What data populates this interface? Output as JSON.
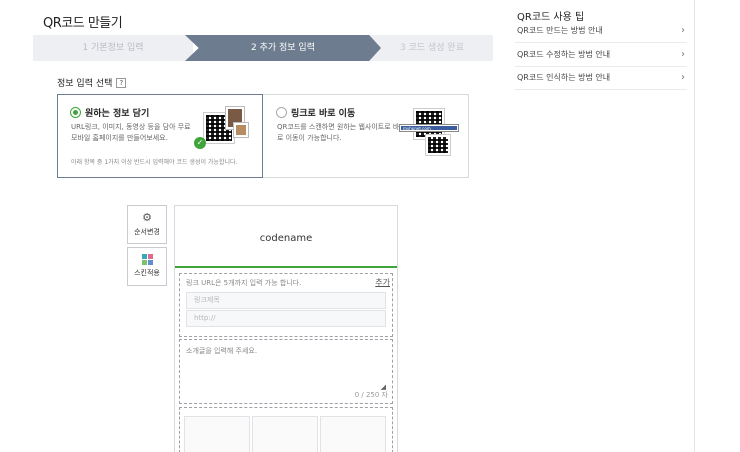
{
  "page_title": "QR코드 만들기",
  "steps": [
    {
      "label": "1 기본정보 입력",
      "state": "done"
    },
    {
      "label": "2 추가 정보 입력",
      "state": "active"
    },
    {
      "label": "3 코드 생성 완료",
      "state": "pending"
    }
  ],
  "section": {
    "label": "정보 입력 선택",
    "help_icon": "?"
  },
  "options": [
    {
      "title": "원하는 정보 담기",
      "selected": true,
      "description": "URL링크, 이미지, 동영상 등을 담아 무료 모바일 홈페이지를 만들어보세요.",
      "note": "아래 항목 중 1가지 이상 반드시 입력해야 코드 생성이 가능합니다."
    },
    {
      "title": "링크로 바로 이동",
      "selected": false,
      "description": "QR코드를 스캔하면 원하는 웹사이트로 바로 이동이 가능합니다.",
      "url_sample": "myhpnet.com"
    }
  ],
  "tools": [
    {
      "label": "순서변경",
      "icon": "gear-icon"
    },
    {
      "label": "스킨적용",
      "icon": "grid-icon"
    }
  ],
  "editor": {
    "codename": "codename",
    "link_hint": "링크 URL은 5개까지 입력 가능 합니다.",
    "link_add": "추가",
    "link_title_placeholder": "링크제목",
    "link_url_placeholder": "http://",
    "intro_placeholder": "소개글을 입력해 주세요.",
    "counter": "0 / 250 자"
  },
  "sidebar": {
    "title": "QR코드 사용 팁",
    "tips": [
      "QR코드 만드는 방법 안내",
      "QR코드 수정하는 방법 안내",
      "QR코드 인식하는 방법 안내"
    ]
  },
  "colors": {
    "accent_green": "#3fa43a",
    "step_active": "#6d7c8e"
  }
}
